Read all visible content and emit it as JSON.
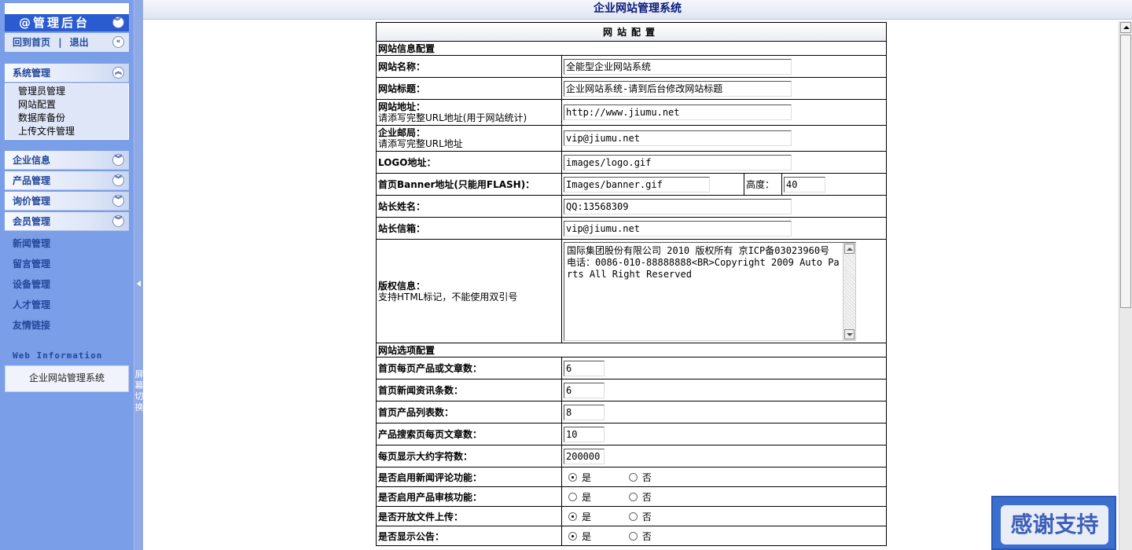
{
  "app": {
    "title": "企业网站管理系统"
  },
  "sidebar": {
    "header": "@管理后台",
    "links": {
      "home": "回到首页",
      "sep": "|",
      "logout": "退出"
    },
    "sections": {
      "system": {
        "label": "系统管理",
        "items": [
          "管理员管理",
          "网站配置",
          "数据库备份",
          "上传文件管理"
        ]
      },
      "company": {
        "label": "企业信息"
      },
      "product": {
        "label": "产品管理"
      },
      "inquiry": {
        "label": "询价管理"
      },
      "member": {
        "label": "会员管理"
      }
    },
    "plain_items": [
      "新闻管理",
      "留言管理",
      "设备管理",
      "人才管理",
      "友情链接"
    ],
    "web_info_title": "Web Information",
    "web_info_text": "企业网站管理系统",
    "toggle_text": "屏幕切换"
  },
  "config": {
    "title": "网站配置",
    "group_info": "网站信息配置",
    "site_name": {
      "label": "网站名称：",
      "value": "全能型企业网站系统"
    },
    "site_title": {
      "label": "网站标题：",
      "value": "企业网站系统-请到后台修改网站标题"
    },
    "site_url": {
      "label": "网站地址：",
      "hint": "请添写完整URL地址(用于网站统计)",
      "value": "http://www.jiumu.net"
    },
    "site_mail": {
      "label": "企业邮局：",
      "hint": "请添写完整URL地址",
      "value": "vip@jiumu.net"
    },
    "logo": {
      "label": "LOGO地址：",
      "value": "images/logo.gif"
    },
    "banner": {
      "label": "首页Banner地址(只能用FLASH)：",
      "value": "Images/banner.gif",
      "height_label": "高度：",
      "height_value": "40"
    },
    "owner_name": {
      "label": "站长姓名：",
      "value": "QQ:13568309"
    },
    "owner_mail": {
      "label": "站长信箱：",
      "value": "vip@jiumu.net"
    },
    "copyright": {
      "label": "版权信息：",
      "hint": "支持HTML标记，不能使用双引号",
      "value": "国际集团股份有限公司 2010 版权所有 京ICP备03023960号 电话：0086-010-88888888<BR>Copyright 2009 Auto Parts All Right Reserved"
    },
    "group_options": "网站选项配置",
    "per_page": {
      "label": "首页每页产品或文章数：",
      "value": "6"
    },
    "news_count": {
      "label": "首页新闻资讯条数：",
      "value": "6"
    },
    "product_cols": {
      "label": "首页产品列表数：",
      "value": "8"
    },
    "search_per_page": {
      "label": "产品搜索页每页文章数：",
      "value": "10"
    },
    "max_chars": {
      "label": "每页显示大约字符数：",
      "value": "200000"
    },
    "yes": "是",
    "no": "否",
    "news_comment": {
      "label": "是否启用新闻评论功能：",
      "selected": "是"
    },
    "product_audit": {
      "label": "是否启用产品审核功能：",
      "selected": "none"
    },
    "file_upload": {
      "label": "是否开放文件上传：",
      "selected": "是"
    },
    "show_notice": {
      "label": "是否显示公告：",
      "selected": "是"
    }
  },
  "badge": {
    "text": "感谢支持"
  }
}
